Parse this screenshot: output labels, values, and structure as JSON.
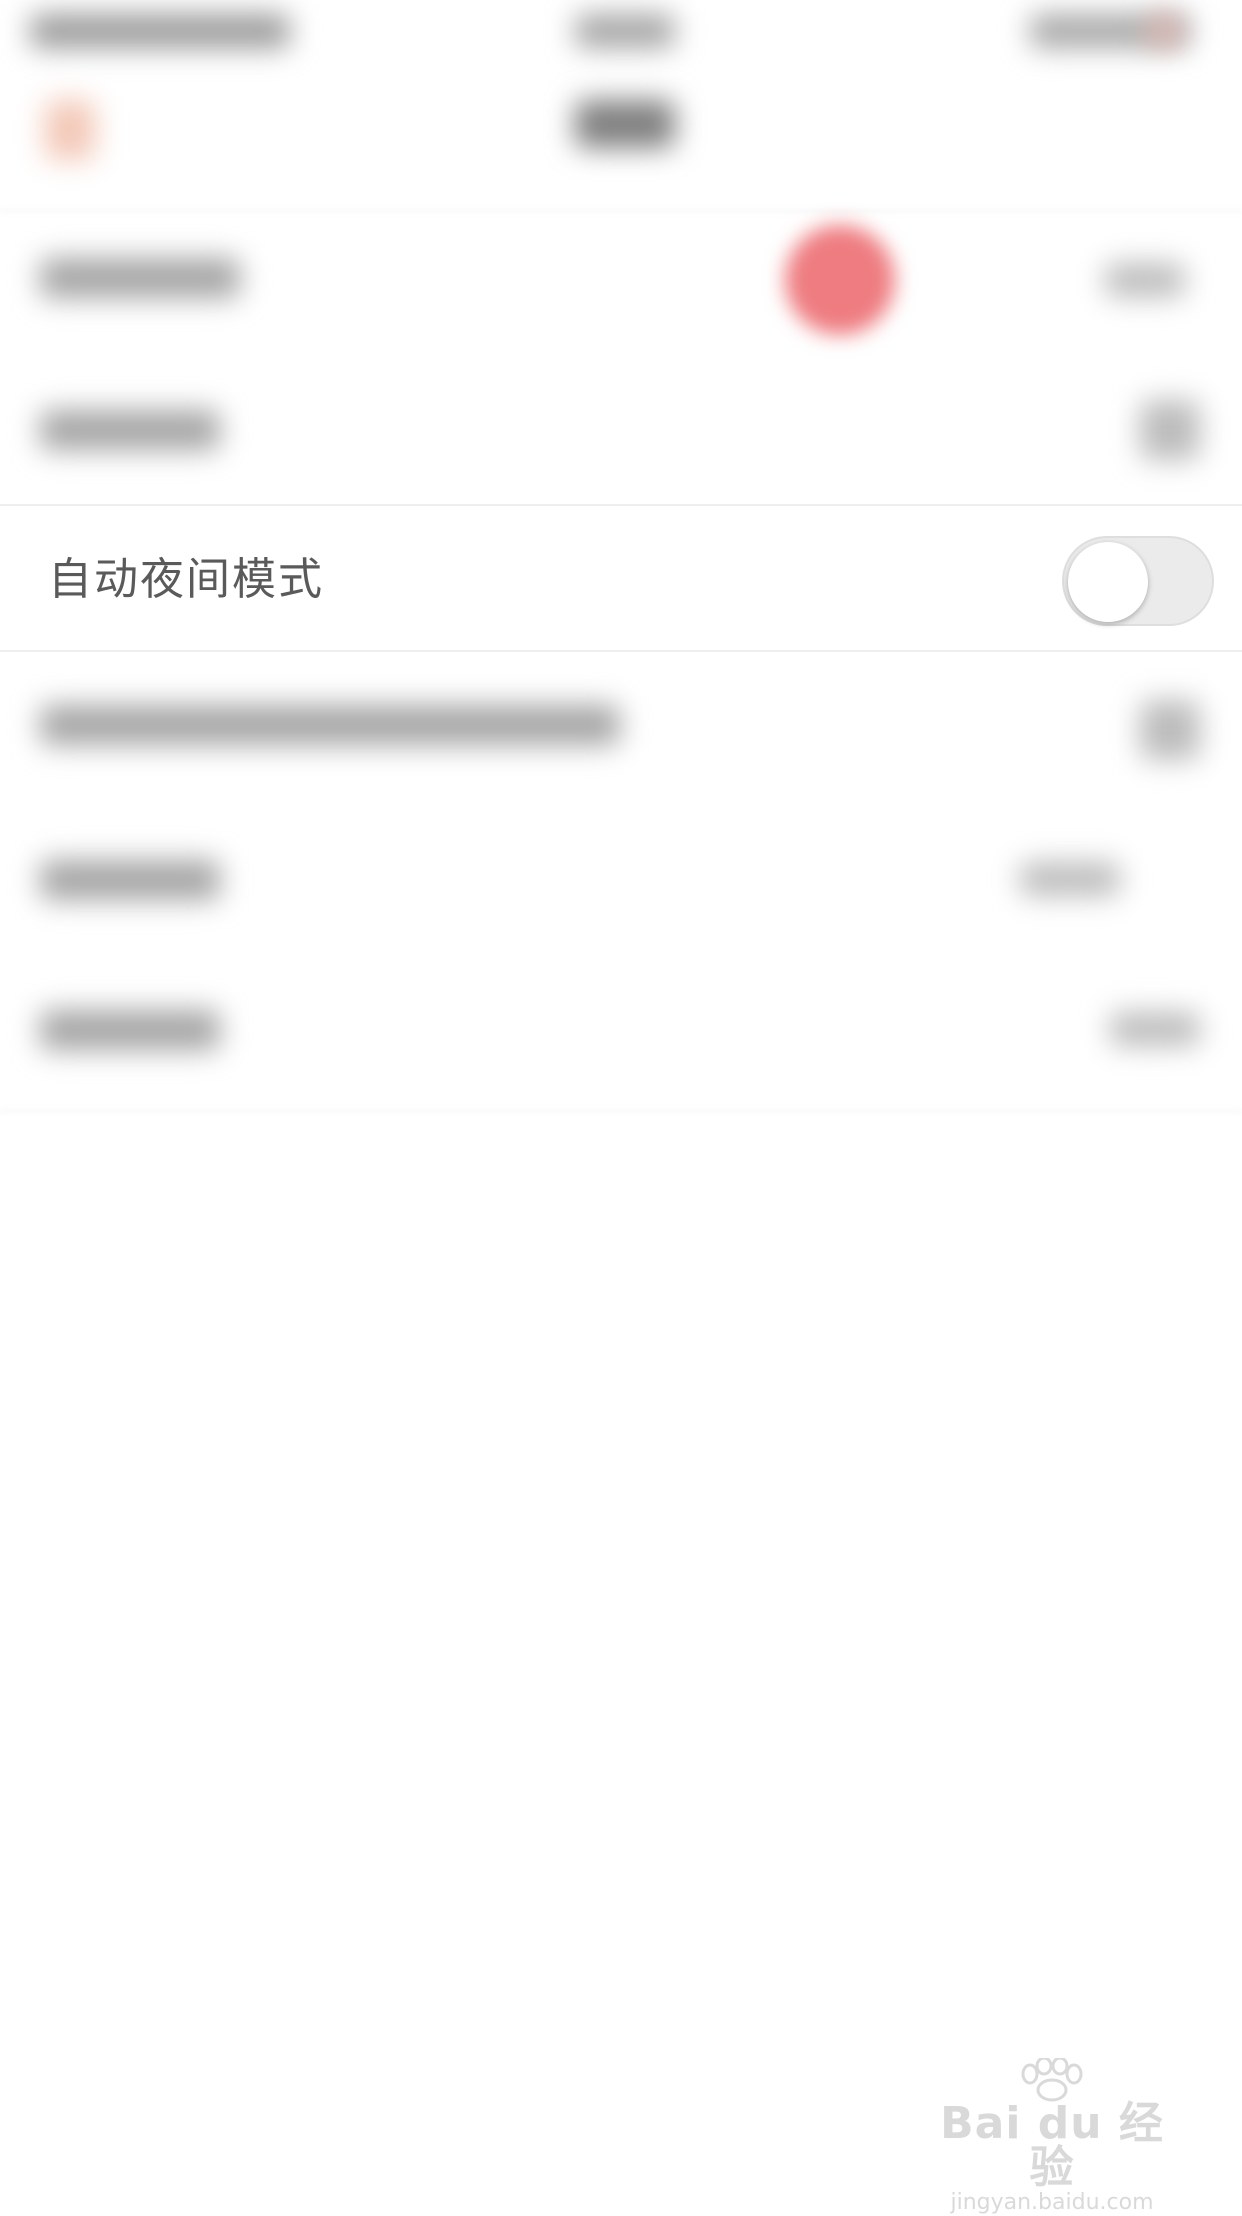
{
  "settings": {
    "night_mode": {
      "label": "自动夜间模式",
      "enabled": false
    }
  },
  "watermark": {
    "brand": "Bai du 经验",
    "url": "jingyan.baidu.com"
  },
  "colors": {
    "background": "#ffffff",
    "label_text": "#5a5a5a",
    "switch_off_track": "#ebebeb",
    "accent_blur_red": "#ee7c80",
    "watermark_gray": "#d9d9d9"
  }
}
